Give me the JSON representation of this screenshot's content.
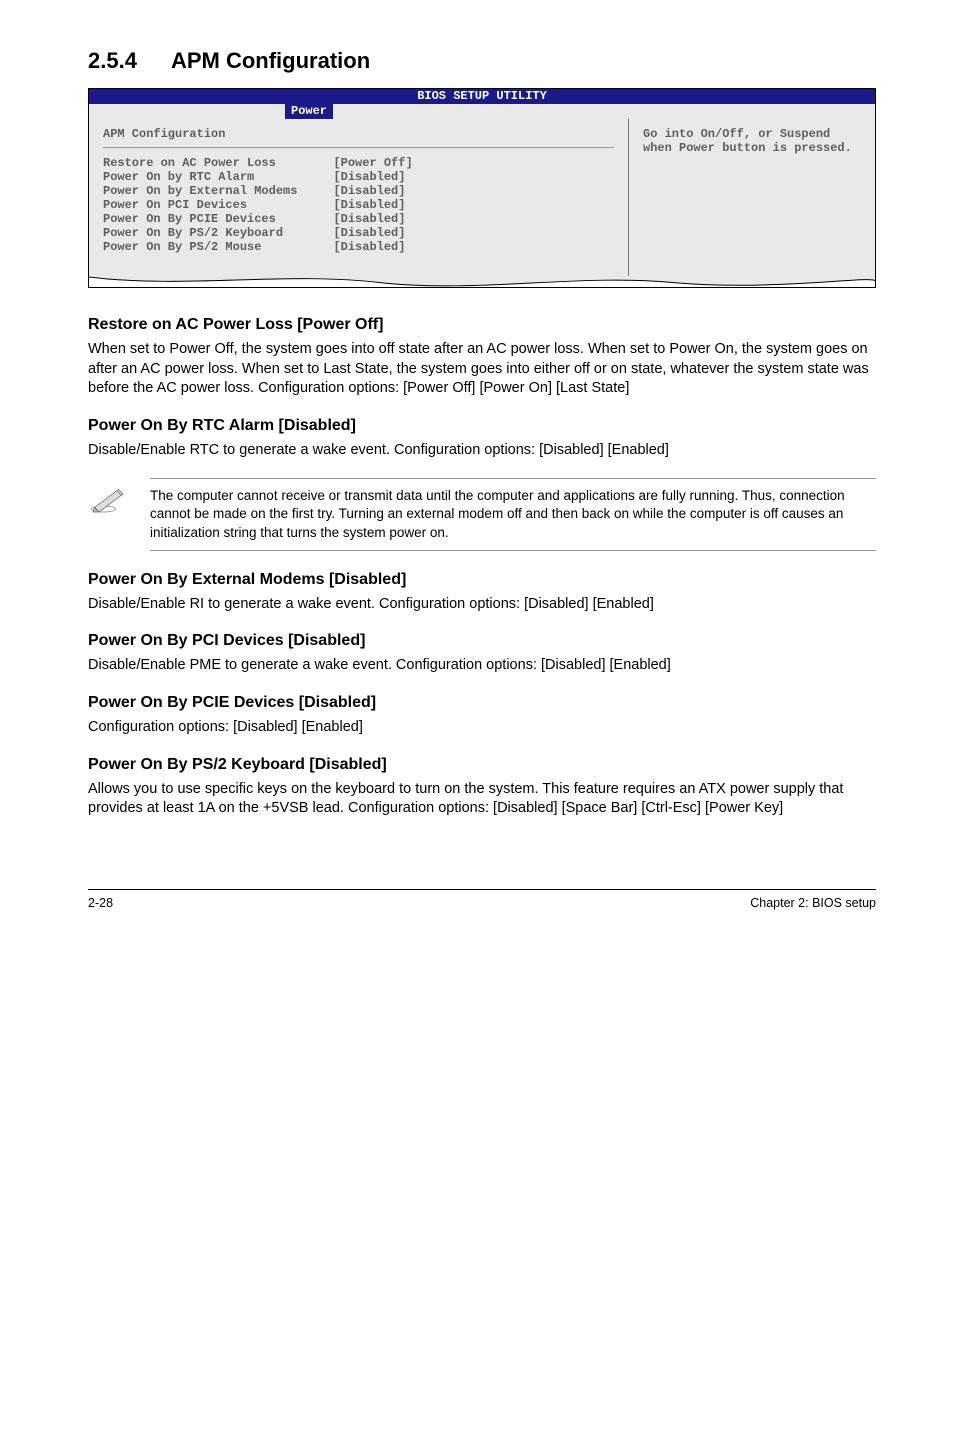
{
  "section": {
    "number": "2.5.4",
    "title": "APM Configuration"
  },
  "bios": {
    "headerTitle": "BIOS SETUP UTILITY",
    "tab": "Power",
    "leftTitle": "APM Configuration",
    "rows": [
      {
        "label": "Restore on AC Power Loss",
        "value": "[Power Off]"
      },
      {
        "label": "Power On by RTC Alarm",
        "value": "[Disabled]"
      },
      {
        "label": "Power On by External Modems",
        "value": "[Disabled]"
      },
      {
        "label": "Power On PCI Devices",
        "value": "[Disabled]"
      },
      {
        "label": "Power On By PCIE Devices",
        "value": "[Disabled]"
      },
      {
        "label": "Power On By PS/2 Keyboard",
        "value": "[Disabled]"
      },
      {
        "label": "Power On By PS/2 Mouse",
        "value": "[Disabled]"
      }
    ],
    "help": "Go into On/Off, or Suspend when Power button is pressed."
  },
  "blocks": [
    {
      "heading": "Restore on AC Power Loss [Power Off]",
      "body": "When set to Power Off, the system goes into off state after an AC power loss. When set to Power On, the system goes on after an AC power loss. When set to Last State, the system goes into either off or on state, whatever the system state was before the AC power loss. Configuration options: [Power Off] [Power On] [Last State]"
    },
    {
      "heading": "Power On By RTC Alarm [Disabled]",
      "body": "Disable/Enable RTC to generate a wake event. Configuration options: [Disabled] [Enabled]"
    }
  ],
  "note": "The computer cannot receive or transmit data until the computer and applications are fully running. Thus, connection cannot be made on the first try. Turning an external modem off and then back on while the computer is off causes an initialization string that turns the system power on.",
  "blocks2": [
    {
      "heading": "Power On By External Modems [Disabled]",
      "body": "Disable/Enable RI to generate a wake event. Configuration options: [Disabled] [Enabled]"
    },
    {
      "heading": "Power On By PCI Devices [Disabled]",
      "body": "Disable/Enable PME to generate a wake event.  Configuration options: [Disabled] [Enabled]"
    },
    {
      "heading": "Power On By PCIE Devices [Disabled]",
      "body": "Configuration options: [Disabled] [Enabled]"
    },
    {
      "heading": "Power On By PS/2 Keyboard [Disabled]",
      "body": "Allows you to use specific keys on the keyboard to turn on the system. This feature requires an ATX power supply that provides at least 1A on the +5VSB lead. Configuration options: [Disabled] [Space Bar] [Ctrl-Esc] [Power Key]"
    }
  ],
  "footer": {
    "left": "2-28",
    "right": "Chapter 2: BIOS setup"
  }
}
